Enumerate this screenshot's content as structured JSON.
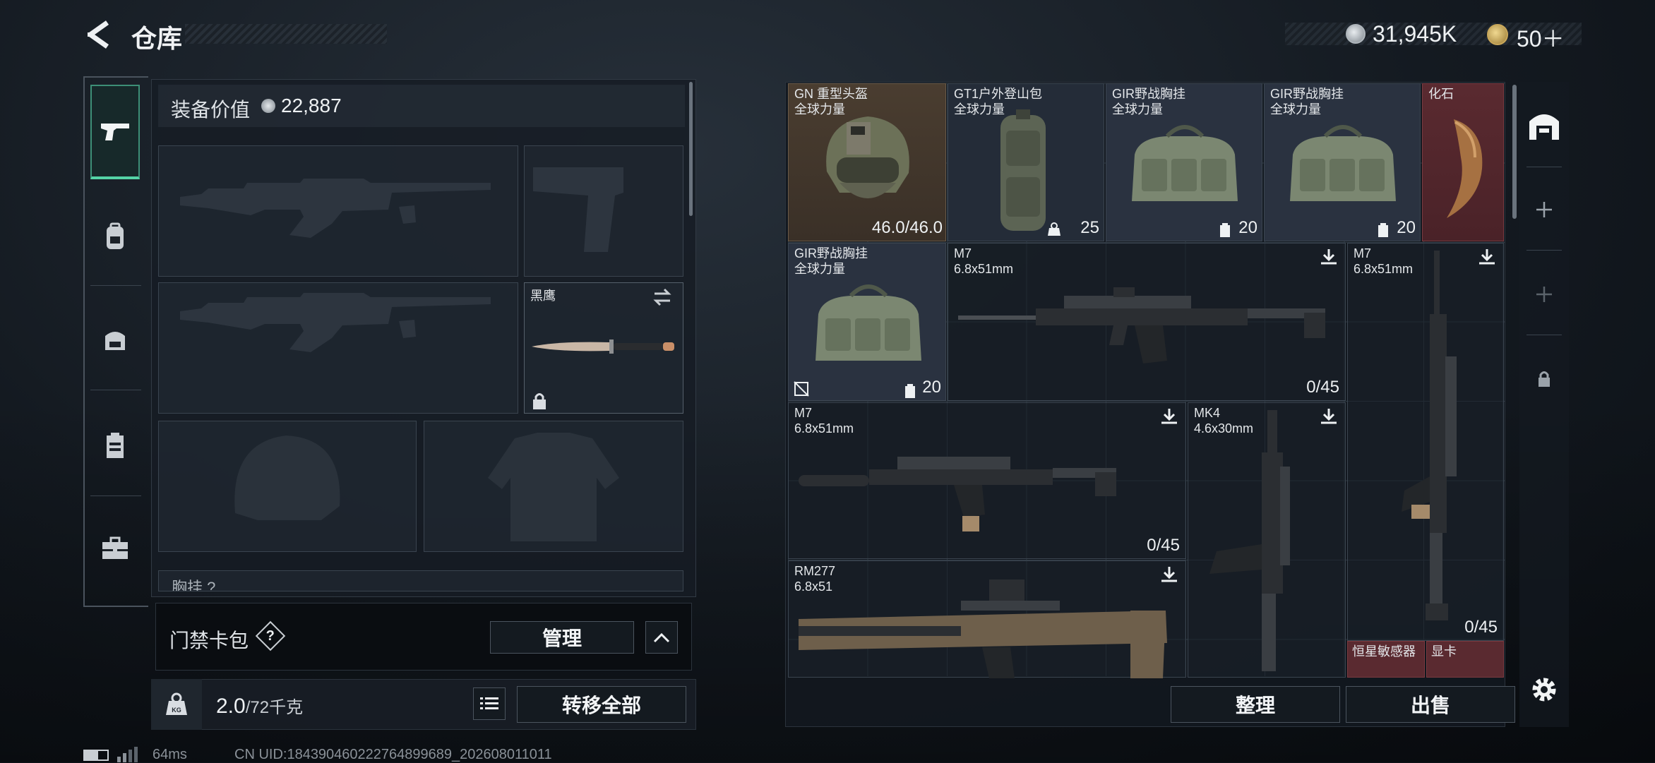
{
  "header": {
    "title": "仓库",
    "coins": "31,945K",
    "premium": "50＋"
  },
  "loadout": {
    "value_label": "装备价值",
    "value": "22,887",
    "melee_name": "黑鹰",
    "chest_rig_label": "胸挂 ?"
  },
  "keycard": {
    "label": "门禁卡包",
    "help_glyph": "?",
    "manage_label": "管理"
  },
  "weight": {
    "current": "2.0",
    "capacity": "/72千克",
    "transfer_all": "转移全部"
  },
  "status": {
    "ping": "64ms",
    "uid": "CN UID:184390460222764899689_202608011011"
  },
  "stash": {
    "organize": "整理",
    "sell": "出售",
    "items": [
      {
        "name": "GN 重型头盔",
        "sub": "全球力量",
        "count": "46.0/46.0"
      },
      {
        "name": "GT1户外登山包",
        "sub": "全球力量",
        "count": "25"
      },
      {
        "name": "GIR野战胸挂",
        "sub": "全球力量",
        "count": "20"
      },
      {
        "name": "GIR野战胸挂",
        "sub": "全球力量",
        "count": "20"
      },
      {
        "name": "化石"
      },
      {
        "name": "GIR野战胸挂",
        "sub": "全球力量",
        "count": "20"
      },
      {
        "name": "M7",
        "sub": "6.8x51mm",
        "count": "0/45"
      },
      {
        "name": "M7",
        "sub": "6.8x51mm",
        "count": "0/45"
      },
      {
        "name": "M7",
        "sub": "6.8x51mm",
        "count": "0/45"
      },
      {
        "name": "MK4",
        "sub": "4.6x30mm"
      },
      {
        "name": "RM277",
        "sub": "6.8x51"
      },
      {
        "name": "恒星敏感器"
      },
      {
        "name": "显卡"
      }
    ]
  }
}
